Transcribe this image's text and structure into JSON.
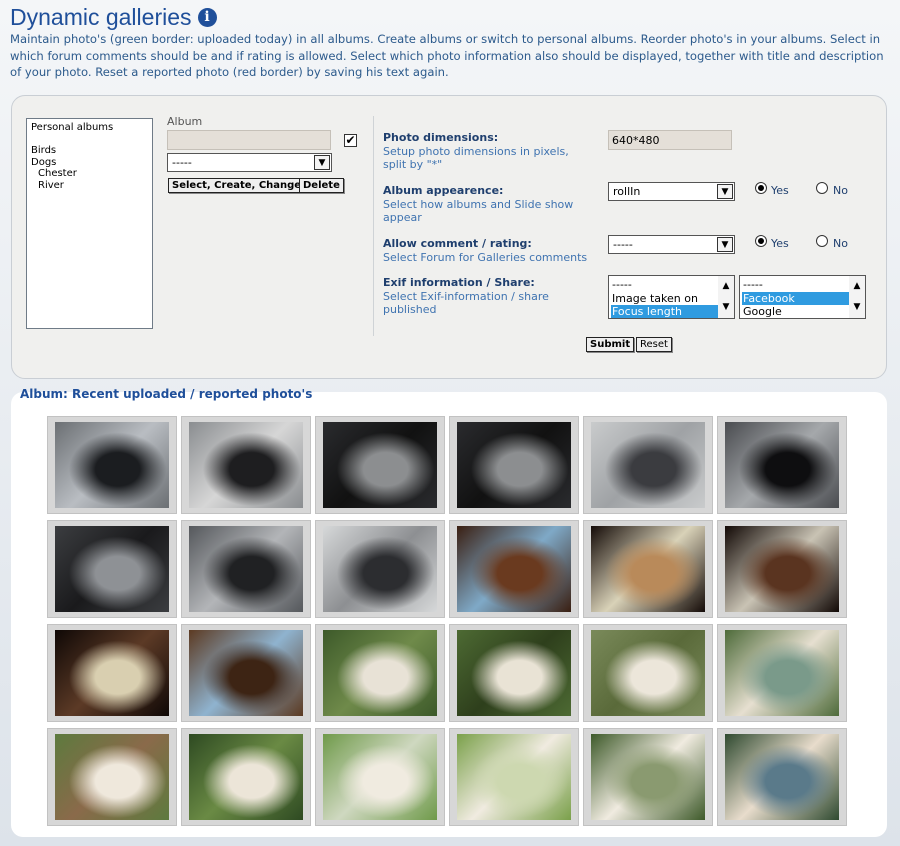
{
  "header": {
    "title": "Dynamic galleries",
    "info_icon": "info-icon",
    "intro": "Maintain photo's (green border: uploaded today) in all albums. Create albums or switch to personal albums. Reorder photo's in your albums. Select in which forum comments should be and if rating is allowed. Select which photo information also should be displayed, together with title and description of your photo. Reset a reported photo (red border) by saving his text again."
  },
  "albums": {
    "tree": [
      "Personal albums",
      "",
      "Birds",
      "Dogs",
      "Chester",
      "River"
    ],
    "label": "Album",
    "name_value": "",
    "checkbox_checked": true,
    "select_value": "-----",
    "select_create_change": "Select, Create, Change",
    "delete": "Delete"
  },
  "settings": {
    "dimensions": {
      "label": "Photo dimensions:",
      "help": "Setup photo dimensions in pixels, split by \"*\"",
      "value": "640*480"
    },
    "appearance": {
      "label": "Album appearence:",
      "help": "Select how albums and Slide show appear",
      "value": "rollIn",
      "yes": "Yes",
      "no": "No",
      "selected": "yes"
    },
    "comments": {
      "label": "Allow comment / rating:",
      "help": "Select Forum for Galleries comments",
      "value": "-----",
      "yes": "Yes",
      "no": "No",
      "selected": "yes"
    },
    "exif": {
      "label": "Exif information / Share:",
      "help": "Select Exif-information / share published",
      "exif_options": [
        "-----",
        "Image taken on",
        "Focus length"
      ],
      "exif_selected": [
        "Focus length"
      ],
      "share_options": [
        "-----",
        "Facebook",
        "Google"
      ],
      "share_selected": [
        "Facebook"
      ]
    },
    "submit": "Submit",
    "reset": "Reset"
  },
  "gallery": {
    "title": "Album: Recent uploaded / reported photo's",
    "photos": [
      {
        "subject": "motorcycle",
        "colors": [
          "#6b6f73",
          "#1b1d20",
          "#b9bdc2"
        ]
      },
      {
        "subject": "motorcycle",
        "colors": [
          "#8a8d90",
          "#1e1e20",
          "#d6d6d6"
        ]
      },
      {
        "subject": "motorcycle",
        "colors": [
          "#2a2b2e",
          "#8c8e90",
          "#111"
        ]
      },
      {
        "subject": "motorcycle",
        "colors": [
          "#2a2b2e",
          "#8c8e90",
          "#111"
        ]
      },
      {
        "subject": "motorcycle",
        "colors": [
          "#c9cbcc",
          "#3b3c40",
          "#9fa2a5"
        ]
      },
      {
        "subject": "motorcycle",
        "colors": [
          "#4a4c50",
          "#0e0e10",
          "#a5a8ab"
        ]
      },
      {
        "subject": "motorcycle",
        "colors": [
          "#3b3d40",
          "#8e9195",
          "#1a1a1c"
        ]
      },
      {
        "subject": "motorcycle",
        "colors": [
          "#55585c",
          "#202123",
          "#b3b5b8"
        ]
      },
      {
        "subject": "motorcycle",
        "colors": [
          "#d6d8d9",
          "#2c2d30",
          "#8d8f92"
        ]
      },
      {
        "subject": "cockatiel",
        "colors": [
          "#3a1f12",
          "#6a3a1f",
          "#7fa9c7"
        ]
      },
      {
        "subject": "cockatiel",
        "colors": [
          "#140b08",
          "#b98a5a",
          "#d9d2b8"
        ]
      },
      {
        "subject": "cockatiel",
        "colors": [
          "#120906",
          "#5a3420",
          "#c9c3b4"
        ]
      },
      {
        "subject": "cockatiel",
        "colors": [
          "#0f0806",
          "#d9cfb0",
          "#5c3a26"
        ]
      },
      {
        "subject": "cockatiel",
        "colors": [
          "#5c3a22",
          "#3d2414",
          "#8fb3cf"
        ]
      },
      {
        "subject": "dog",
        "colors": [
          "#3d5a2a",
          "#e8e2d6",
          "#6f8a4a"
        ]
      },
      {
        "subject": "dog",
        "colors": [
          "#4d6a33",
          "#e9e3d5",
          "#2e3f1c"
        ]
      },
      {
        "subject": "dog",
        "colors": [
          "#7a8a5a",
          "#ece6da",
          "#5a6a3a"
        ]
      },
      {
        "subject": "dog",
        "colors": [
          "#4e6b3a",
          "#7a9a8a",
          "#e6dfd0"
        ]
      },
      {
        "subject": "dog",
        "colors": [
          "#5d7a3e",
          "#efe8dc",
          "#8a6a4a"
        ]
      },
      {
        "subject": "dog",
        "colors": [
          "#2e4a22",
          "#ece5d8",
          "#6a8a44"
        ]
      },
      {
        "subject": "dog",
        "colors": [
          "#6f9a4a",
          "#f0ebe0",
          "#cfd8c0"
        ]
      },
      {
        "subject": "dog",
        "colors": [
          "#7aa04a",
          "#cdd8b0",
          "#f0ebe0"
        ]
      },
      {
        "subject": "dog",
        "colors": [
          "#3e5a2a",
          "#8a9a70",
          "#f0ebe0"
        ]
      },
      {
        "subject": "dog",
        "colors": [
          "#2f4a30",
          "#5a7a8a",
          "#e8dccc"
        ]
      }
    ]
  }
}
